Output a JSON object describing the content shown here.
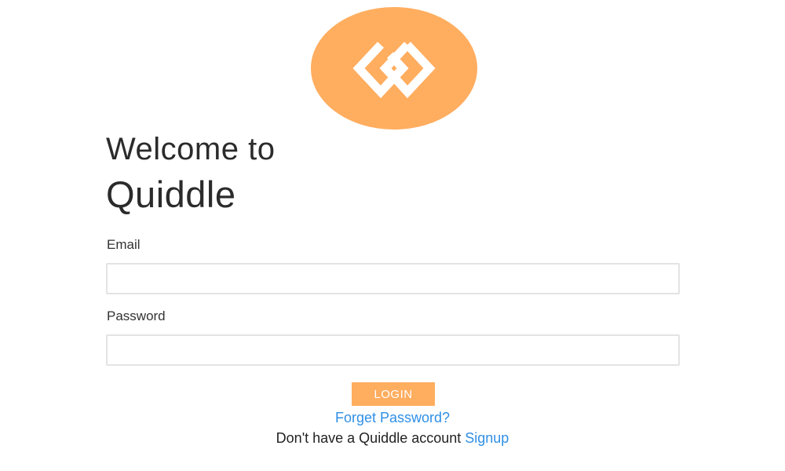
{
  "brand": {
    "logo_icon": "interlocking-squares-logo-icon",
    "accent_color": "#ffad5f",
    "link_color": "#2f8fe6"
  },
  "header": {
    "welcome_line": "Welcome to",
    "app_name": "Quiddle"
  },
  "form": {
    "email_label": "Email",
    "email_value": "",
    "email_placeholder": "",
    "password_label": "Password",
    "password_value": "",
    "password_placeholder": "",
    "login_label": "LOGIN"
  },
  "links": {
    "forgot_password": "Forget Password?",
    "signup_prompt": "Don't have a Quiddle account",
    "signup_label": "Signup"
  }
}
